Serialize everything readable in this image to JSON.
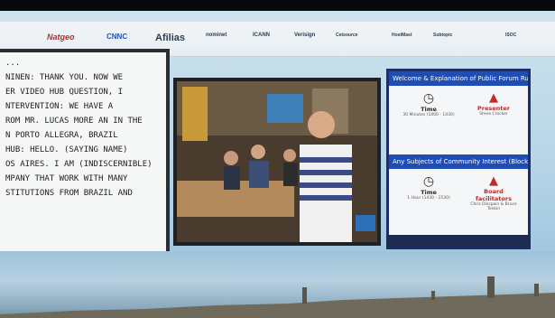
{
  "sponsor_logos": [
    "Natgeo",
    "CNNC",
    "Afilias",
    "nominet",
    "ICANN",
    "Verisign",
    "Cetsource",
    "HostMast",
    "Subtopic",
    "ISOC"
  ],
  "captions": [
    "...",
    "NINEN: THANK YOU. NOW WE",
    "ER VIDEO HUB QUESTION, I",
    "",
    "NTERVENTION: WE HAVE A",
    "ROM MR. LUCAS MORE AN IN THE",
    "N PORTO ALLEGRA, BRAZIL",
    "",
    "HUB: HELLO. (SAYING NAME)",
    "OS AIRES. I AM (INDISCERNIBLE)",
    "MPANY THAT WORK WITH MANY",
    "STITUTIONS FROM BRAZIL AND"
  ],
  "panel": {
    "header1": "Welcome & Explanation of Public Forum Rules",
    "header2": "Any Subjects of Community Interest (Block 1)",
    "items": [
      {
        "icon": "clock-icon",
        "label": "Time",
        "sub": "30 Minutes (1400 - 1430)"
      },
      {
        "icon": "person-icon",
        "label": "Presenter",
        "sub": "Steve Crocker"
      },
      {
        "icon": "clock-icon",
        "label": "Time",
        "sub": "1 Hour (1430 - 1530)"
      },
      {
        "icon": "person-icon",
        "label": "Board facilitators",
        "sub": "Chris Disspain & Bruce Tonkin"
      }
    ]
  },
  "colors": {
    "panel_header": "#1f4db3",
    "presenter_red": "#c62828",
    "sky": "#bcd8e8"
  }
}
